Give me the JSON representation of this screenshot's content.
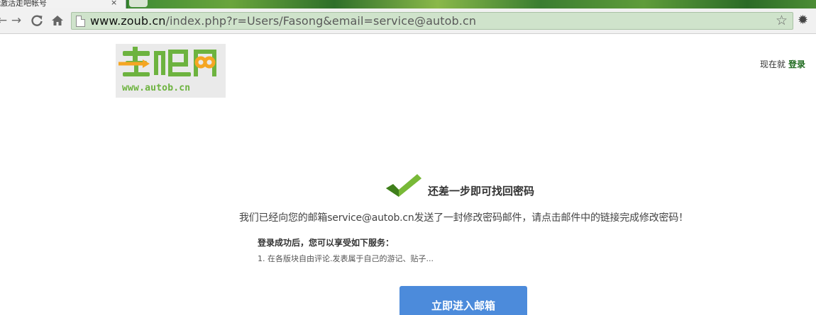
{
  "browser": {
    "tab_title": "激活走吧帐号",
    "tab_close": "×",
    "url_host": "www.zoub.cn",
    "url_path": "/index.php?r=Users/Fasong&email=service@autob.cn"
  },
  "header": {
    "logo_text": "走吧网",
    "logo_url": "www.autob.cn",
    "login_prefix": "现在就",
    "login_link": "登录"
  },
  "main": {
    "headline": "还差一步即可找回密码",
    "description": "我们已经向您的邮箱service@autob.cn发送了一封修改密码邮件，请点击邮件中的链接完成修改密码！",
    "benefits_title": "登录成功后，您可以享受如下服务：",
    "benefits": [
      "1. 在各版块自由评论.发表属于自己的游记、贴子..."
    ],
    "mail_button": "立即进入邮箱"
  },
  "colors": {
    "logo_green": "#6db33f",
    "logo_orange": "#f5a623",
    "button_blue": "#4c8bdb",
    "link_green": "#1f6b1f"
  }
}
